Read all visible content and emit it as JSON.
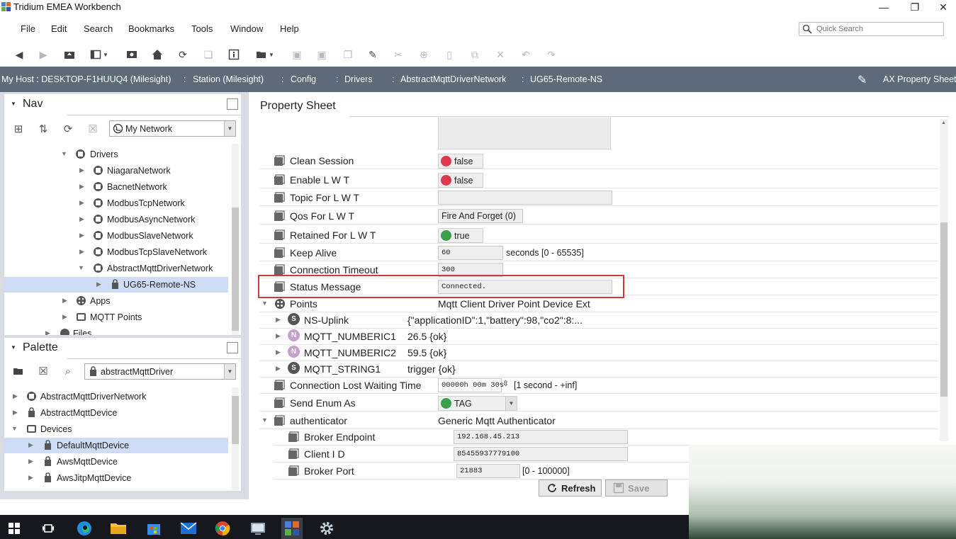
{
  "window": {
    "title": "Tridium EMEA Workbench"
  },
  "menu": [
    "File",
    "Edit",
    "Search",
    "Bookmarks",
    "Tools",
    "Window",
    "Help"
  ],
  "quick_search": {
    "placeholder": "Quick Search"
  },
  "breadcrumb": [
    "My Host : DESKTOP-F1HUUQ4 (Milesight)",
    "Station (Milesight)",
    "Config",
    "Drivers",
    "AbstractMqttDriverNetwork",
    "UG65-Remote-NS"
  ],
  "view_name": "AX Property Sheet",
  "nav": {
    "title": "Nav",
    "dropdown": "My Network",
    "tree": [
      {
        "label": "Drivers",
        "expanded": true
      },
      {
        "label": "NiagaraNetwork"
      },
      {
        "label": "BacnetNetwork"
      },
      {
        "label": "ModbusTcpNetwork"
      },
      {
        "label": "ModbusAsyncNetwork"
      },
      {
        "label": "ModbusSlaveNetwork"
      },
      {
        "label": "ModbusTcpSlaveNetwork"
      },
      {
        "label": "AbstractMqttDriverNetwork",
        "expanded": true
      },
      {
        "label": "UG65-Remote-NS",
        "selected": true
      },
      {
        "label": "Apps"
      },
      {
        "label": "MQTT Points"
      },
      {
        "label": "Files"
      }
    ]
  },
  "palette": {
    "title": "Palette",
    "dropdown": "abstractMqttDriver",
    "tree": [
      {
        "label": "AbstractMqttDriverNetwork"
      },
      {
        "label": "AbstractMqttDevice"
      },
      {
        "label": "Devices",
        "expanded": true
      },
      {
        "label": "DefaultMqttDevice",
        "selected": true
      },
      {
        "label": "AwsMqttDevice"
      },
      {
        "label": "AwsJitpMqttDevice"
      }
    ]
  },
  "property_sheet": {
    "tab": "Property Sheet",
    "rows": {
      "clean_session": {
        "name": "Clean Session",
        "value": "false"
      },
      "enable_lwt": {
        "name": "Enable L W T",
        "value": "false"
      },
      "topic_lwt": {
        "name": "Topic For L W T",
        "value": ""
      },
      "qos_lwt": {
        "name": "Qos For L W T",
        "value": "Fire And Forget (0)"
      },
      "retained_lwt": {
        "name": "Retained For L W T",
        "value": "true"
      },
      "keep_alive": {
        "name": "Keep Alive",
        "value": "60",
        "range": "seconds [0 - 65535]"
      },
      "conn_timeout": {
        "name": "Connection Timeout",
        "value": "300"
      },
      "status_message": {
        "name": "Status Message",
        "value": "Connected."
      },
      "points": {
        "name": "Points",
        "value": "Mqtt Client Driver Point Device Ext"
      },
      "ns_uplink": {
        "tag": "S",
        "name": "NS-Uplink",
        "value": "{\"applicationID\":1,\"battery\":98,\"co2\":8:..."
      },
      "mqtt_numberic1": {
        "tag": "N",
        "name": "MQTT_NUMBERIC1",
        "value": "26.5 {ok}"
      },
      "mqtt_numberic2": {
        "tag": "N",
        "name": "MQTT_NUMBERIC2",
        "value": "59.5 {ok}"
      },
      "mqtt_string1": {
        "tag": "S",
        "name": "MQTT_STRING1",
        "value": "trigger {ok}"
      },
      "conn_lost_wait": {
        "name": "Connection Lost Waiting Time",
        "value": "00000h 00m 30s",
        "range": "[1 second - +inf]"
      },
      "send_enum_as": {
        "name": "Send Enum As",
        "value": "TAG"
      },
      "authenticator": {
        "name": "authenticator",
        "value": "Generic Mqtt Authenticator"
      },
      "broker_endpoint": {
        "name": "Broker Endpoint",
        "value": "192.168.45.213"
      },
      "client_id": {
        "name": "Client I D",
        "value": "85455937779100"
      },
      "broker_port": {
        "name": "Broker Port",
        "value": "21883",
        "range": "[0 - 100000]"
      }
    },
    "buttons": {
      "refresh": "Refresh",
      "save": "Save"
    }
  },
  "colors": {
    "breadcrumb_bg": "#5e6a7a",
    "false_dot": "#e0394b",
    "true_dot": "#3aa14a",
    "selection": "#cfdcf5",
    "highlight_box": "#d13a3a"
  },
  "icons": [
    "back-icon",
    "forward-icon",
    "home-icon",
    "refresh-icon",
    "cut-icon",
    "copy-icon",
    "paste-icon",
    "delete-icon",
    "undo-icon",
    "redo-icon",
    "search-icon",
    "gear-icon"
  ]
}
